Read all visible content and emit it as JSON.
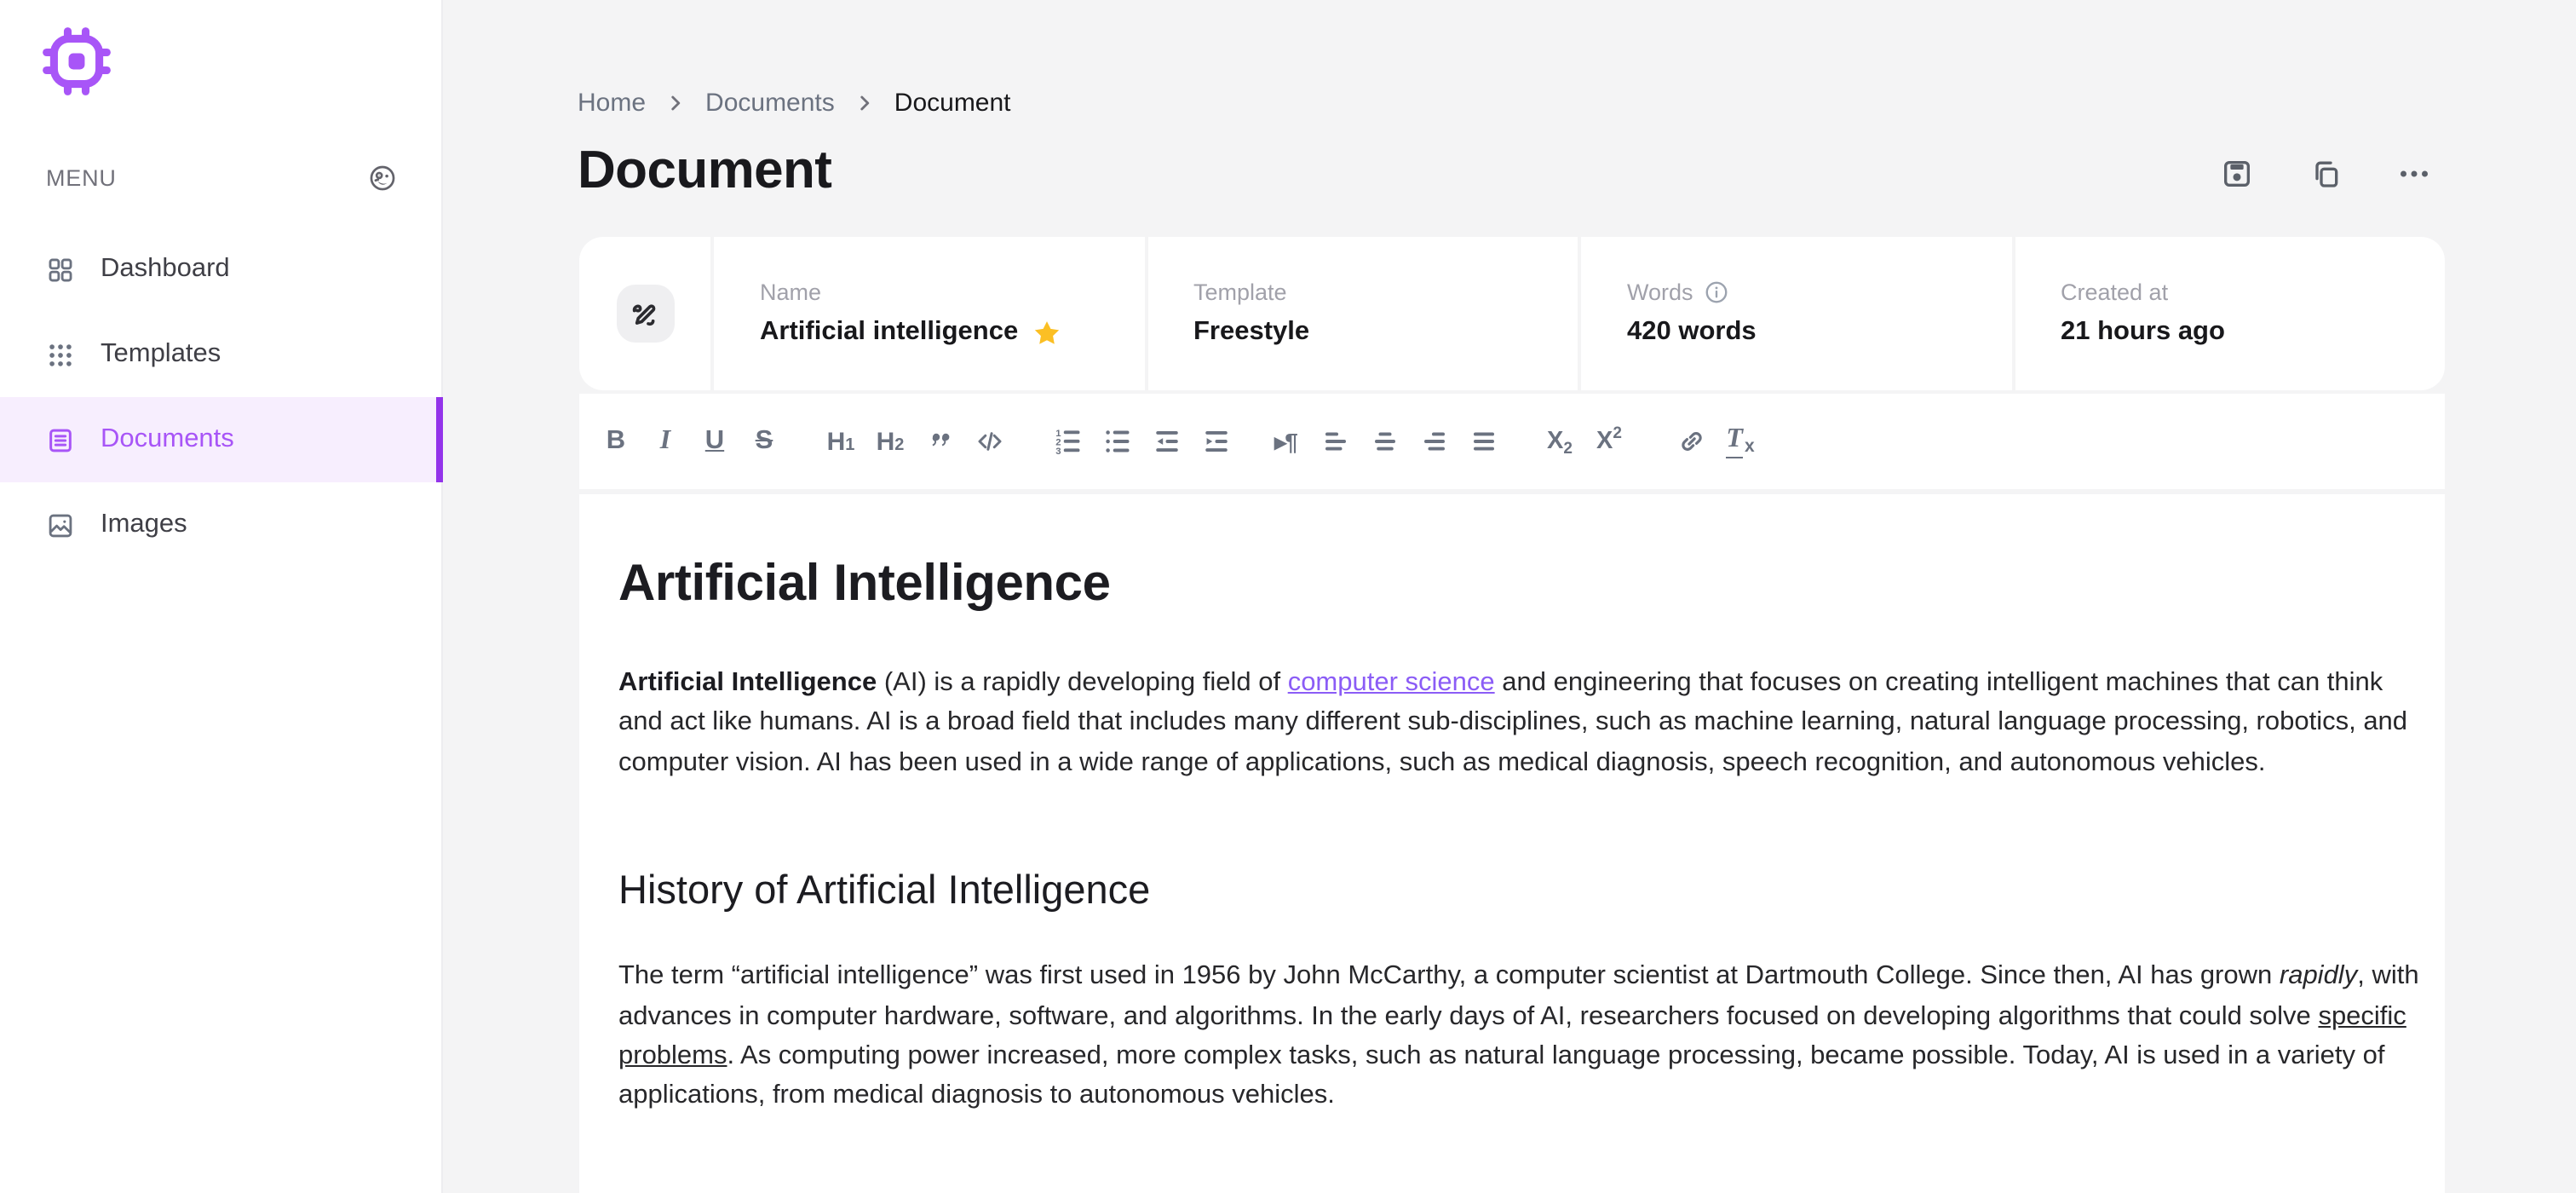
{
  "colors": {
    "brand_purple": "#a855f7",
    "active_purple": "#9333ea",
    "active_bg": "#f7eefe",
    "link_purple": "#8b5cf6",
    "star_yellow": "#fbbf24",
    "page_bg": "#f4f4f5",
    "text_dark": "#18181b",
    "icon_gray": "#6b7280"
  },
  "sidebar": {
    "menu_label": "MENU",
    "items": [
      {
        "label": "Dashboard",
        "icon": "grid-icon",
        "active": false
      },
      {
        "label": "Templates",
        "icon": "dots-grid-icon",
        "active": false
      },
      {
        "label": "Documents",
        "icon": "document-lines-icon",
        "active": true
      },
      {
        "label": "Images",
        "icon": "photo-icon",
        "active": false
      }
    ]
  },
  "breadcrumb": {
    "items": [
      {
        "label": "Home",
        "current": false
      },
      {
        "label": "Documents",
        "current": false
      },
      {
        "label": "Document",
        "current": true
      }
    ]
  },
  "header": {
    "title": "Document",
    "actions": [
      "save",
      "copy",
      "more-options"
    ]
  },
  "meta": {
    "cells": [
      {
        "label": "Name",
        "value": "Artificial intelligence",
        "has_star": true
      },
      {
        "label": "Template",
        "value": "Freestyle"
      },
      {
        "label": "Words",
        "value": "420 words",
        "has_info": true
      },
      {
        "label": "Created at",
        "value": "21 hours ago"
      }
    ],
    "name_label": "Name",
    "name_value": "Artificial intelligence",
    "template_label": "Template",
    "template_value": "Freestyle",
    "words_label": "Words",
    "words_value": "420 words",
    "created_label": "Created at",
    "created_value": "21 hours ago"
  },
  "toolbar": {
    "bold": "B",
    "italic": "I",
    "underline": "U",
    "strike": "S",
    "h_letter": "H",
    "h1_num": "1",
    "h2_num": "2",
    "sub_base": "X",
    "sub_num": "2",
    "sup_base": "X",
    "sup_num": "2",
    "para_dir": "▸¶",
    "clear_t": "T",
    "clear_x": "x"
  },
  "document": {
    "blocks": [
      {
        "type": "h1",
        "text": "Artificial Intelligence"
      },
      {
        "type": "p",
        "segments": [
          {
            "t": "Artificial Intelligence",
            "style": "bold"
          },
          {
            "t": " (AI) is a rapidly developing field of "
          },
          {
            "t": "computer science",
            "style": "link"
          },
          {
            "t": " and engineering that focuses on creating intelligent machines that can think and act like humans. AI is a broad field that includes many different sub-disciplines, such as machine learning, natural language processing, robotics, and computer vision. AI has been used in a wide range of applications, such as medical diagnosis, speech recognition, and autonomous vehicles."
          }
        ]
      },
      {
        "type": "h2",
        "text": "History of Artificial Intelligence"
      },
      {
        "type": "p",
        "segments": [
          {
            "t": "The term “artificial intelligence” was first used in 1956 by John McCarthy, a computer scientist at Dartmouth College. Since then, AI has grown "
          },
          {
            "t": "rapidly",
            "style": "italic"
          },
          {
            "t": ", with advances in computer hardware, software, and algorithms. In the early days of AI, researchers focused on developing algorithms that could solve "
          },
          {
            "t": "specific problems",
            "style": "underline"
          },
          {
            "t": ". As computing power increased, more complex tasks, such as natural language processing, became possible. Today, AI is used in a variety of applications, from medical diagnosis to autonomous vehicles."
          }
        ]
      }
    ]
  }
}
